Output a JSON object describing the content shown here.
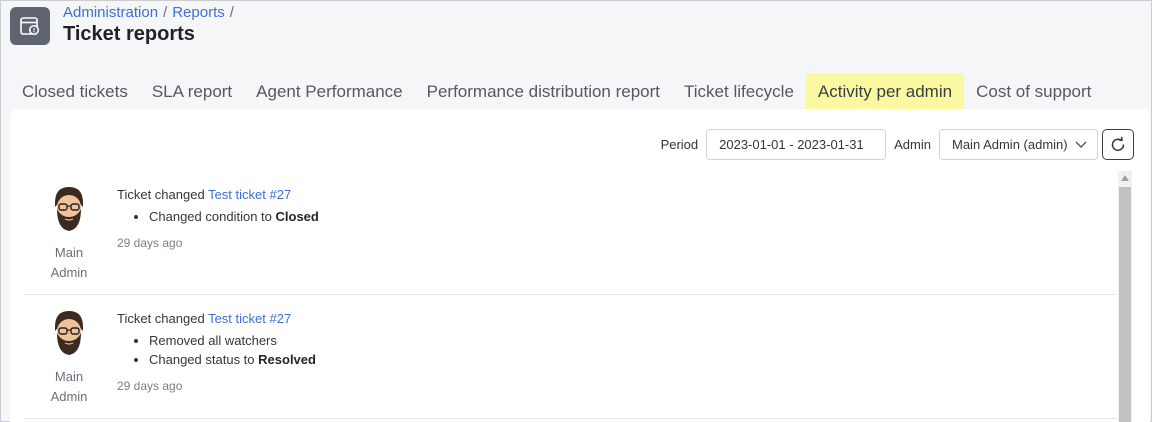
{
  "breadcrumb": {
    "items": [
      "Administration",
      "Reports"
    ],
    "separator": "/"
  },
  "page_title": "Ticket reports",
  "tabs": [
    {
      "label": "Closed tickets",
      "active": false
    },
    {
      "label": "SLA report",
      "active": false
    },
    {
      "label": "Agent Performance",
      "active": false
    },
    {
      "label": "Performance distribution report",
      "active": false
    },
    {
      "label": "Ticket lifecycle",
      "active": false
    },
    {
      "label": "Activity per admin",
      "active": true
    },
    {
      "label": "Cost of support",
      "active": false
    }
  ],
  "filters": {
    "period_label": "Period",
    "period_value": "2023-01-01 - 2023-01-31",
    "admin_label": "Admin",
    "admin_value": "Main Admin (admin)"
  },
  "entries": [
    {
      "author_first": "Main",
      "author_last": "Admin",
      "action": "Ticket changed",
      "ticket_link": "Test ticket #27",
      "changes": [
        {
          "text": "Changed condition to",
          "value": "Closed"
        }
      ],
      "time": "29 days ago"
    },
    {
      "author_first": "Main",
      "author_last": "Admin",
      "action": "Ticket changed",
      "ticket_link": "Test ticket #27",
      "changes": [
        {
          "text": "Removed all watchers",
          "value": ""
        },
        {
          "text": "Changed status to",
          "value": "Resolved"
        }
      ],
      "time": "29 days ago"
    }
  ],
  "colors": {
    "accent_link": "#3f6fd6",
    "active_tab_bg": "#fbf8a2",
    "page_icon_bg": "#5f6570"
  },
  "icons": {
    "page_icon": "report-calendar-icon",
    "refresh": "refresh-icon",
    "dropdown": "chevron-down-icon",
    "avatar": "bearded-man-avatar"
  }
}
